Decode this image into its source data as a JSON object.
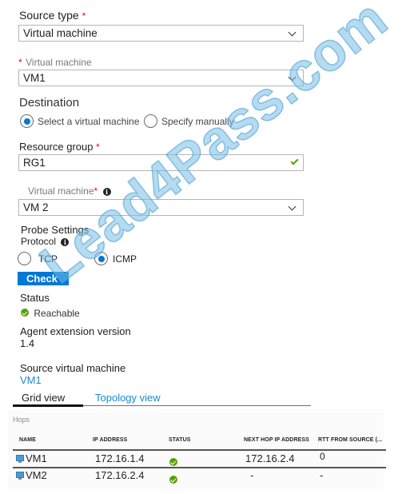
{
  "source_type": {
    "label": "Source type",
    "required_mark": "*",
    "value": "Virtual machine"
  },
  "source_vm": {
    "required_mark": "*",
    "label": "Virtual machine",
    "value": "VM1"
  },
  "destination": {
    "title": "Destination",
    "options": [
      {
        "label": "Select a virtual machine",
        "selected": true
      },
      {
        "label": "Specify manually",
        "selected": false
      }
    ]
  },
  "resource_group": {
    "label": "Resource group",
    "required_mark": "*",
    "value": "RG1",
    "valid_icon": "checkmark-icon"
  },
  "dest_vm": {
    "label": "Virtual machine",
    "required_mark": "*",
    "info_glyph": "i",
    "value": "VM 2"
  },
  "probe": {
    "title": "Probe Settings",
    "protocol_label": "Protocol",
    "info_glyph": "i",
    "options": [
      {
        "label": "TCP",
        "selected": false
      },
      {
        "label": "ICMP",
        "selected": true
      }
    ],
    "check_button": "Check",
    "accent": "#0078d4"
  },
  "result": {
    "status_label": "Status",
    "status_value": "Reachable",
    "status_color": "#57a300",
    "agent_label": "Agent extension version",
    "agent_value": "1.4",
    "source_vm_label": "Source virtual machine",
    "source_vm_value": "VM1"
  },
  "tabs": [
    {
      "label": "Grid view",
      "active": true
    },
    {
      "label": "Topology view",
      "active": false
    }
  ],
  "hops": {
    "title": "Hops",
    "columns": [
      "NAME",
      "IP ADDRESS",
      "STATUS",
      "NEXT HOP IP ADDRESS",
      "RTT FROM SOURCE (..."
    ],
    "rows": [
      {
        "name": "VM1",
        "ip": "172.16.1.4",
        "status": "ok",
        "next_hop": "172.16.2.4",
        "rtt": "0"
      },
      {
        "name": "VM2",
        "ip": "172.16.2.4",
        "status": "ok",
        "next_hop": "-",
        "rtt": "-"
      }
    ]
  },
  "watermark": "Lead4Pass.com"
}
